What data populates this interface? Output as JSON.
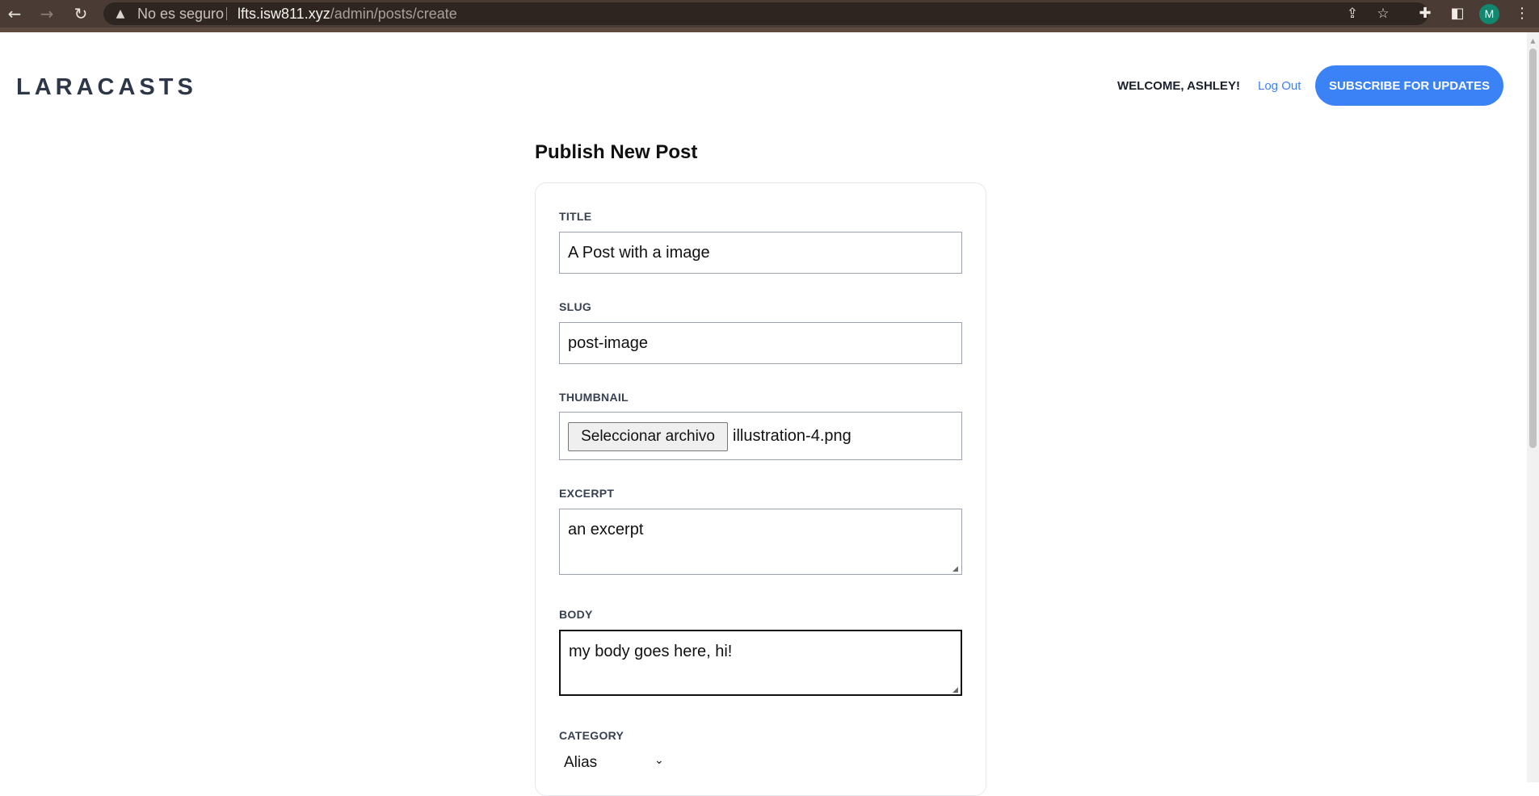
{
  "browser": {
    "security_label": "No es seguro",
    "url_host": "lfts.isw811.xyz",
    "url_path": "/admin/posts/create",
    "profile_initial": "M"
  },
  "header": {
    "logo": "LARACASTS",
    "welcome": "WELCOME, ASHLEY!",
    "logout": "Log Out",
    "subscribe": "SUBSCRIBE FOR UPDATES"
  },
  "form": {
    "heading": "Publish New Post",
    "title_label": "TITLE",
    "title_value": "A Post with a image",
    "slug_label": "SLUG",
    "slug_value": "post-image",
    "thumbnail_label": "THUMBNAIL",
    "file_button": "Seleccionar archivo",
    "file_name": "illustration-4.png",
    "excerpt_label": "EXCERPT",
    "excerpt_value": "an excerpt",
    "body_label": "BODY",
    "body_value": "my body goes here, hi!",
    "category_label": "CATEGORY",
    "category_value": "Alias"
  },
  "colors": {
    "accent": "#3b82f6",
    "chrome": "#4a3c34"
  }
}
